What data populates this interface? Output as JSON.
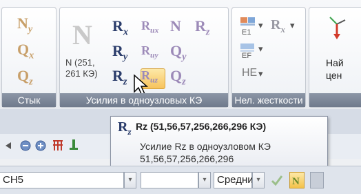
{
  "ribbon": {
    "groups": {
      "styk": {
        "label": "Стык"
      },
      "efforts": {
        "label": "Усилия в одноузловых КЭ"
      },
      "nonlin": {
        "label": "Нел. жесткости"
      },
      "find": {
        "label_line1": "Най",
        "label_line2": "цен"
      }
    },
    "styk_items": {
      "ny": {
        "main": "N",
        "sub": "y"
      },
      "qx": {
        "main": "Q",
        "sub": "x"
      },
      "qz": {
        "main": "Q",
        "sub": "z"
      }
    },
    "big_n": {
      "main": "N",
      "caption": "N (251, 261 КЭ)"
    },
    "effort_grid": [
      {
        "main": "R",
        "sub": "x"
      },
      {
        "main": "R",
        "sub": "ux"
      },
      {
        "main": "N",
        "sub": ""
      },
      {
        "main": "R",
        "sub": "z"
      },
      {
        "main": "R",
        "sub": "y"
      },
      {
        "main": "R",
        "sub": "uy"
      },
      {
        "main": "Q",
        "sub": "y"
      },
      {
        "main": "R",
        "sub": "z"
      },
      {
        "main": "R",
        "sub": "uz"
      },
      {
        "main": "Q",
        "sub": "z"
      }
    ],
    "nonlin_items": {
      "e1": "E1",
      "ef": "EF",
      "he": "HE"
    }
  },
  "tooltip": {
    "icon": {
      "main": "R",
      "sub": "z"
    },
    "title": "Rz (51,56,57,256,266,296 КЭ)",
    "line1": "Усилие Rz в одноузловом КЭ",
    "line2": "51,56,57,256,266,296"
  },
  "bottom": {
    "field_value": "CH5",
    "combo_value": "Средни"
  }
}
